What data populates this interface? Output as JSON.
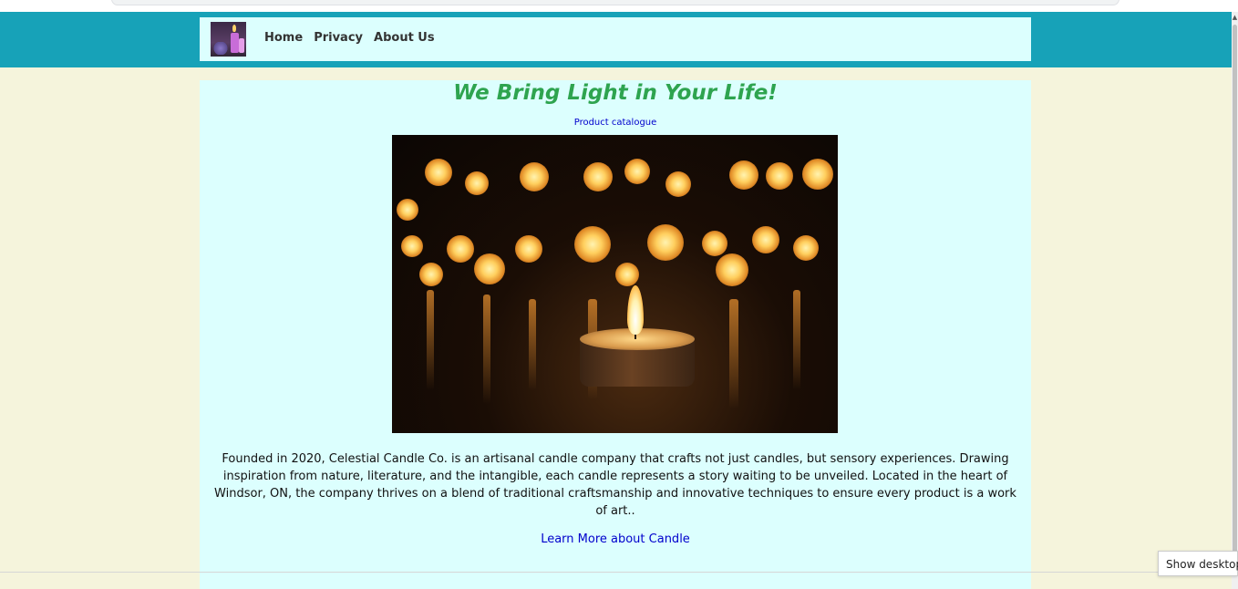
{
  "nav": {
    "logo_icon": "candle-logo",
    "links": [
      "Home",
      "Privacy",
      "About Us"
    ]
  },
  "hero": {
    "title": "We Bring Light in Your Life!",
    "catalogue_link": "Product catalogue",
    "image_icon": "candles-photo"
  },
  "content": {
    "description": "Founded in 2020, Celestial Candle Co. is an artisanal candle company that crafts not just candles, but sensory experiences. Drawing inspiration from nature, literature, and the intangible, each candle represents a story waiting to be unveiled. Located in the heart of Windsor, ON, the company thrives on a blend of traditional craftsmanship and innovative techniques to ensure every product is a work of art..",
    "learn_more": "Learn More about Candle"
  },
  "system": {
    "tooltip": "Show desktop"
  },
  "colors": {
    "header": "#17a2b8",
    "card": "#dcfffe",
    "page": "#f5f4dc",
    "title": "#2ea44f",
    "link": "#0000cc"
  }
}
